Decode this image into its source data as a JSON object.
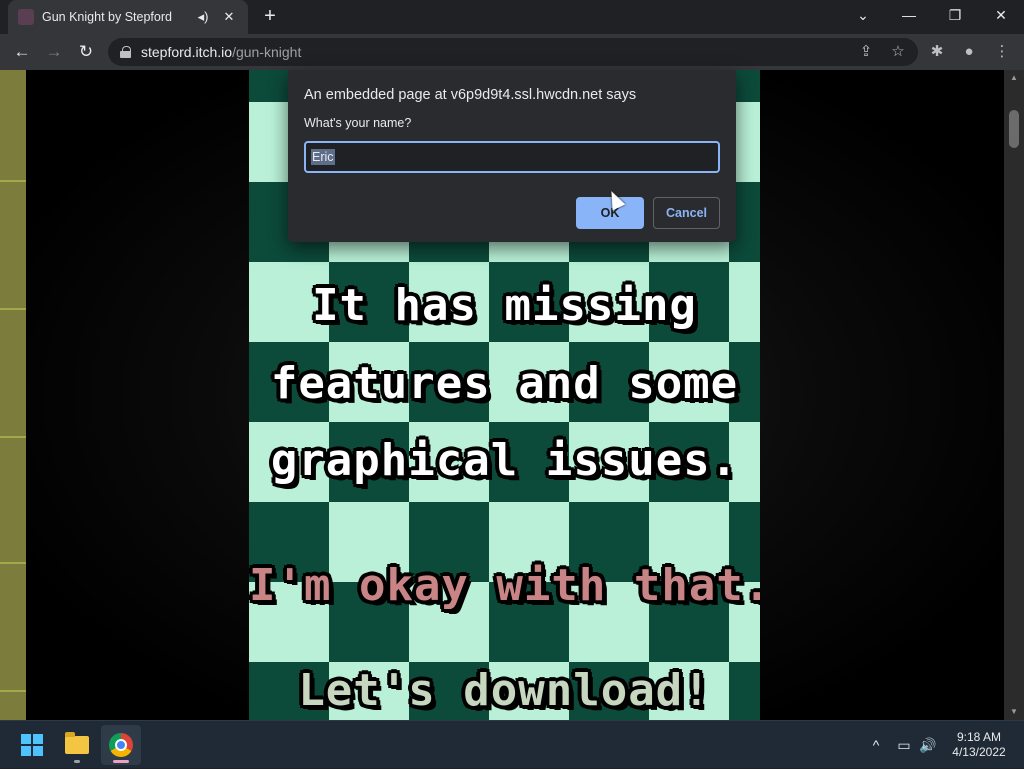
{
  "browser": {
    "tab": {
      "title": "Gun Knight by Stepford",
      "audio_icon": "speaker-icon",
      "close_glyph": "✕"
    },
    "new_tab_glyph": "+",
    "window": {
      "tab_search_glyph": "⌄",
      "minimize_glyph": "—",
      "restore_glyph": "❐",
      "close_glyph": "✕"
    },
    "nav": {
      "back_glyph": "←",
      "forward_glyph": "→",
      "reload_glyph": "↻"
    },
    "address": {
      "host": "stepford.itch.io",
      "path": "/gun-knight"
    },
    "actions": {
      "share_glyph": "⇪",
      "bookmark_glyph": "☆",
      "extensions_glyph": "✱",
      "profile_glyph": "●",
      "menu_glyph": "⋮"
    }
  },
  "game": {
    "lines": [
      {
        "text": "It has missing",
        "color": "#ffffff"
      },
      {
        "text": "features and some",
        "color": "#ffffff"
      },
      {
        "text": "graphical issues.",
        "color": "#ffffff"
      },
      {
        "text": "I'm okay with that.",
        "color": "#c98585"
      },
      {
        "text": "Let's download!",
        "color": "#c7d6bf"
      }
    ],
    "colors": {
      "dark_tile": "#0c4a3a",
      "light_tile": "#b9f0d7"
    }
  },
  "dialog": {
    "title": "An embedded page at v6p9d9t4.ssl.hwcdn.net says",
    "message": "What's your name?",
    "input_value": "Eric",
    "ok_label": "OK",
    "cancel_label": "Cancel",
    "accent": "#8ab4f8"
  },
  "taskbar": {
    "tray": {
      "chevron_glyph": "^",
      "network_glyph": "▭",
      "volume_glyph": "🔊"
    },
    "clock": {
      "time": "9:18 AM",
      "date": "4/13/2022"
    }
  }
}
